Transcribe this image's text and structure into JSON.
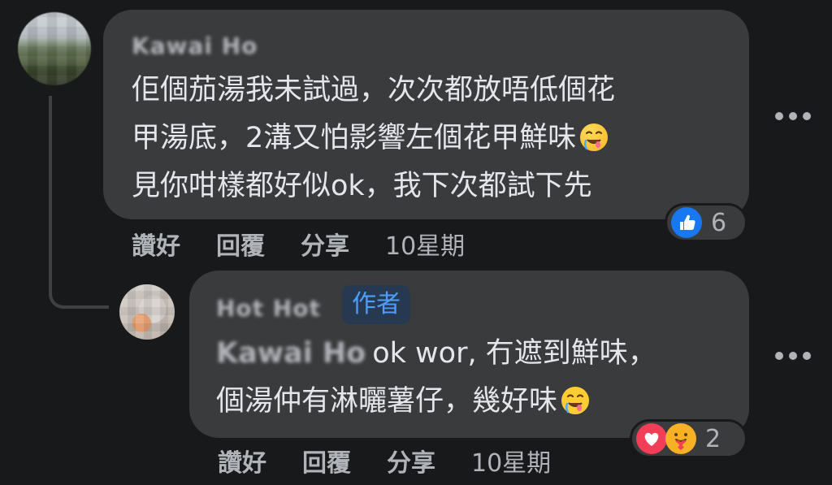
{
  "comments": [
    {
      "author": "Kawai Ho",
      "lines": [
        "佢個茄湯我未試過，次次都放唔低個花",
        "甲湯底，2溝又怕影響左個花甲鮮味",
        "見你咁樣都好似ok，我下次都試下先"
      ],
      "emoji_icon": "drooling-face-emoji",
      "reactions": {
        "icons": [
          "like-reaction-icon"
        ],
        "count": "6"
      },
      "actions": {
        "like": "讚好",
        "reply": "回覆",
        "share": "分享",
        "time": "10星期"
      }
    },
    {
      "author": "Hot Hot",
      "badge": "作者",
      "mention": "Kawai Ho",
      "lines": [
        "ok wor, 冇遮到鮮味，",
        "個湯仲有淋曬薯仔，幾好味"
      ],
      "emoji_icon": "drooling-face-emoji",
      "reactions": {
        "icons": [
          "love-reaction-icon",
          "care-reaction-icon"
        ],
        "count": "2"
      },
      "actions": {
        "like": "讚好",
        "reply": "回覆",
        "share": "分享",
        "time": "10星期"
      }
    }
  ],
  "colors": {
    "background": "#18191a",
    "bubble": "#3a3b3c",
    "text": "#e4e6eb",
    "secondary_text": "#b0b3b8",
    "author_badge_text": "#4d9eff",
    "like_blue": "#1877f2",
    "love_red": "#f33e58"
  }
}
